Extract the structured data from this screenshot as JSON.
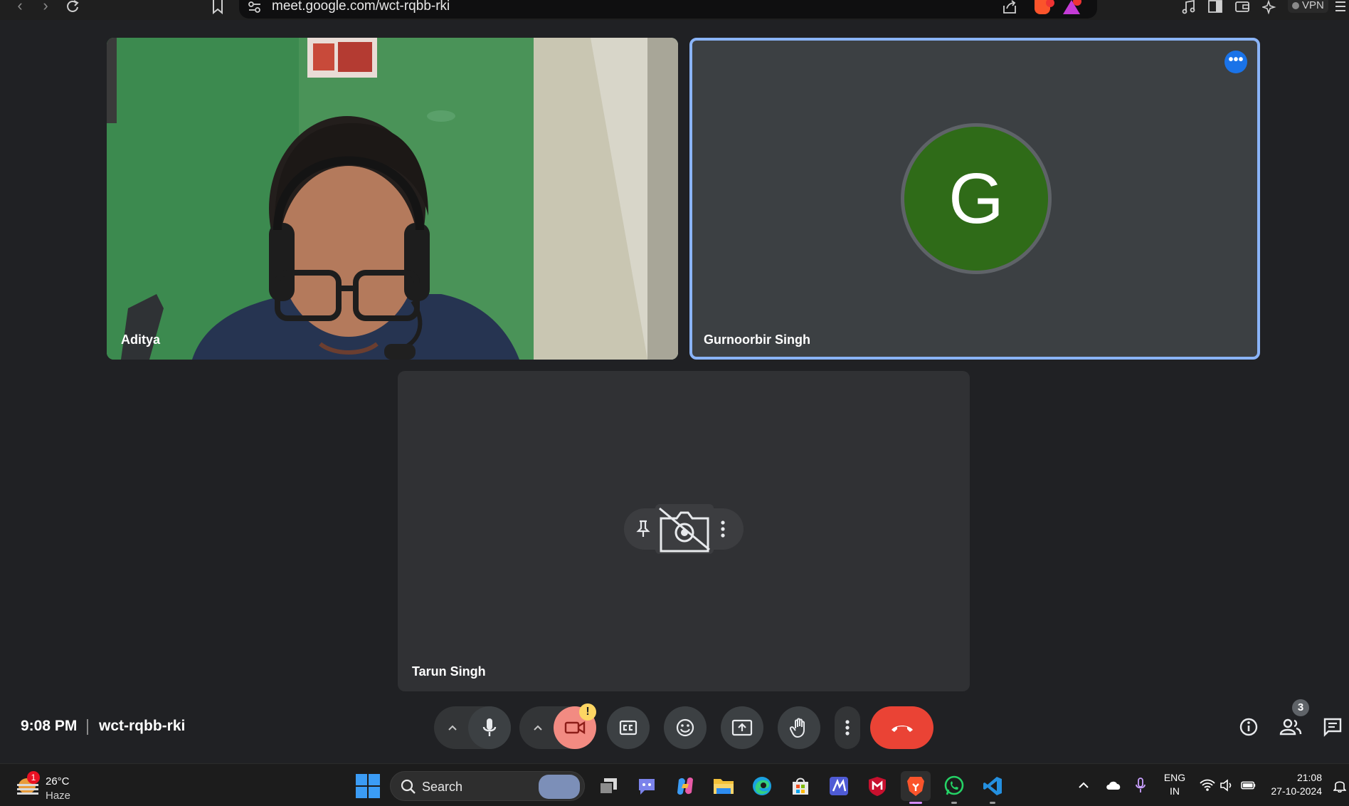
{
  "browser": {
    "url": "meet.google.com/wct-rqbb-rki",
    "vpn_label": "VPN"
  },
  "tiles": {
    "aditya": {
      "name": "Aditya"
    },
    "gurnoor": {
      "name": "Gurnoorbir Singh",
      "initial": "G",
      "avatar_color": "#2f6b18"
    },
    "tarun": {
      "name": "Tarun Singh"
    }
  },
  "meeting": {
    "time": "9:08 PM",
    "code": "wct-rqbb-rki",
    "camera_warning": "!",
    "participant_count": "3",
    "accent_color": "#8ab4f8",
    "leave_color": "#ea4335"
  },
  "taskbar": {
    "weather_badge": "1",
    "temperature": "26°C",
    "condition": "Haze",
    "search_placeholder": "Search",
    "lang_line1": "ENG",
    "lang_line2": "IN",
    "time": "21:08",
    "date": "27-10-2024"
  }
}
